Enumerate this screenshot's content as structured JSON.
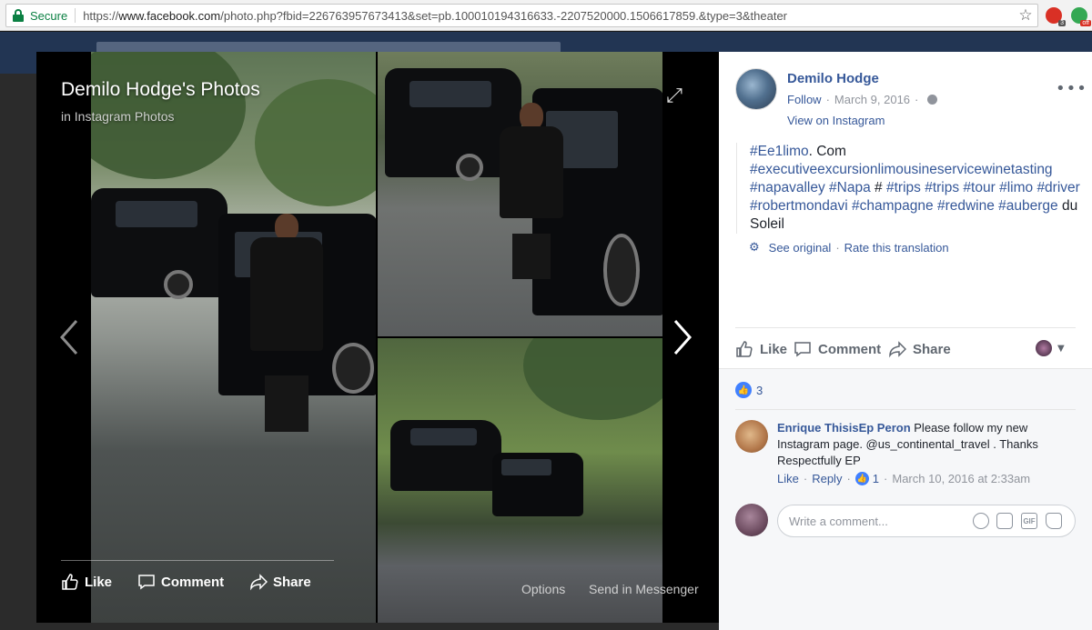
{
  "browser": {
    "secure_label": "Secure",
    "url_scheme": "https://",
    "url_host": "www.facebook.com",
    "url_path": "/photo.php?fbid=226763957673413&set=pb.100010194316633.-2207520000.1506617859.&type=3&theater",
    "extensions": [
      {
        "name": "red-extension",
        "badge": "3",
        "color": "#d93025"
      },
      {
        "name": "green-extension",
        "badge": "off",
        "color": "#34a853"
      }
    ]
  },
  "photo": {
    "title": "Demilo Hodge's Photos",
    "subtitle": "in Instagram Photos",
    "actions": {
      "like": "Like",
      "comment": "Comment",
      "share": "Share"
    },
    "options_label": "Options",
    "send_label": "Send in Messenger"
  },
  "post": {
    "author": "Demilo Hodge",
    "follow_label": "Follow",
    "date": "March 9, 2016",
    "view_on_instagram": "View on Instagram",
    "text_segments": [
      {
        "text": "#Ee1limo",
        "tag": true
      },
      {
        "text": ". Com",
        "tag": false
      },
      {
        "text": "#executiveexcursionlimousineservicewinetasting",
        "tag": true
      },
      {
        "text": "#napavalley",
        "tag": true
      },
      {
        "text": "#Napa",
        "tag": true
      },
      {
        "text": "#",
        "tag": false
      },
      {
        "text": "#trips",
        "tag": true
      },
      {
        "text": "#trips",
        "tag": true
      },
      {
        "text": "#tour",
        "tag": true
      },
      {
        "text": "#limo",
        "tag": true
      },
      {
        "text": "#driver",
        "tag": true
      },
      {
        "text": "#robertmondavi",
        "tag": true
      },
      {
        "text": "#champagne",
        "tag": true
      },
      {
        "text": "#redwine",
        "tag": true
      },
      {
        "text": "#auberge",
        "tag": true
      },
      {
        "text": "du Soleil",
        "tag": false
      }
    ],
    "see_original": "See original",
    "rate_translation": "Rate this translation",
    "actions": {
      "like": "Like",
      "comment": "Comment",
      "share": "Share"
    },
    "reaction_count": "3"
  },
  "comment": {
    "author": "Enrique ThisisEp Peron",
    "text": "Please follow my new Instagram page. @us_continental_travel . Thanks Respectfully EP",
    "like_label": "Like",
    "reply_label": "Reply",
    "like_count": "1",
    "timestamp": "March 10, 2016 at 2:33am"
  },
  "composer": {
    "placeholder": "Write a comment...",
    "gif_label": "GIF"
  },
  "colors": {
    "link": "#365899",
    "secure": "#0b8043",
    "fb_bar": "#223553"
  }
}
